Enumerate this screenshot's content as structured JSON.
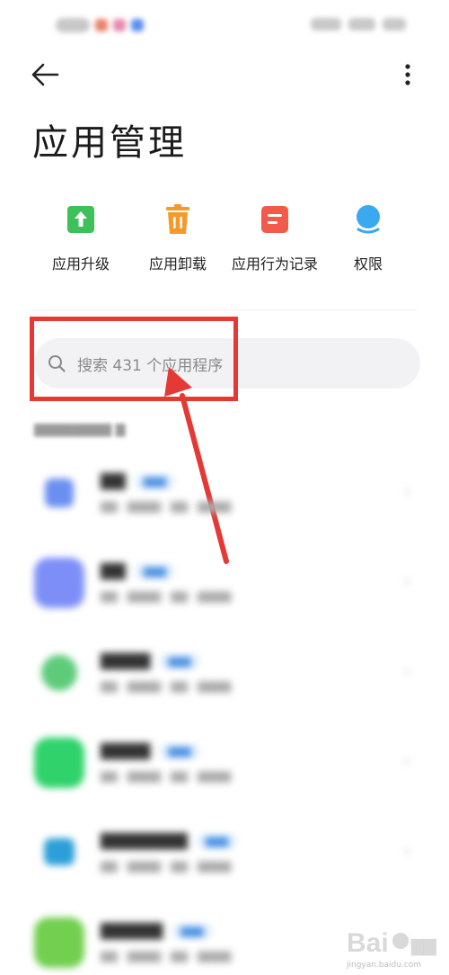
{
  "header": {
    "title": "应用管理",
    "back_icon": "arrow-left-icon",
    "more_icon": "more-vertical-icon"
  },
  "quick_actions": [
    {
      "label": "应用升级",
      "icon": "upgrade-icon",
      "color": "#3ec15a"
    },
    {
      "label": "应用卸载",
      "icon": "trash-icon",
      "color": "#f5992b"
    },
    {
      "label": "应用行为记录",
      "icon": "record-icon",
      "color": "#f25b4c"
    },
    {
      "label": "权限",
      "icon": "permission-icon",
      "color": "#3ba9f0"
    }
  ],
  "search": {
    "placeholder": "搜索 431 个应用程序",
    "icon": "search-icon"
  },
  "colors": {
    "annotation": "#e53935",
    "search_bg": "#f2f2f4"
  }
}
